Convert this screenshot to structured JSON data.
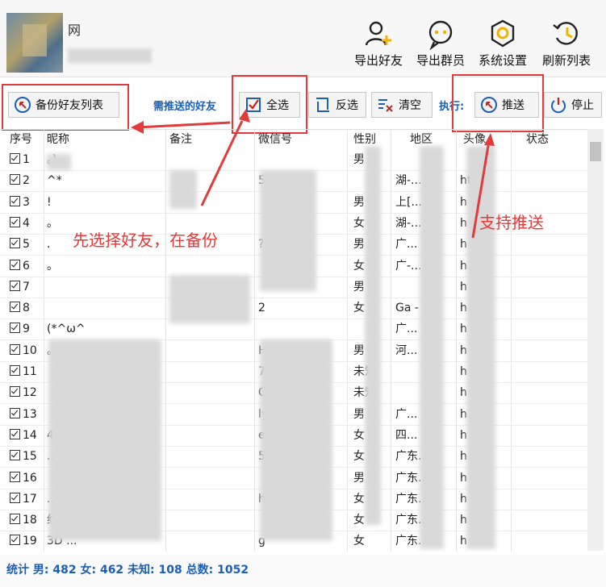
{
  "profile": {
    "name_tail": "网"
  },
  "toolbar": {
    "export_friends": "导出好友",
    "export_groups": "导出群员",
    "settings": "系统设置",
    "refresh": "刷新列表"
  },
  "actions": {
    "backup": "备份好友列表",
    "need_push_label": "需推送的好友",
    "select_all": "全选",
    "invert": "反选",
    "clear": "清空",
    "execute_label": "执行:",
    "push": "推送",
    "stop": "停止"
  },
  "columns": [
    "序号",
    "昵称",
    "备注",
    "微信号",
    "性别",
    "地区",
    "头像",
    "状态"
  ],
  "rows": [
    {
      "no": "1",
      "nick": "。)",
      "note": "",
      "wxid": "",
      "gender": "男",
      "region": "",
      "avatar": ""
    },
    {
      "no": "2",
      "nick": "^*",
      "note": "",
      "wxid": "54...",
      "gender": "",
      "region": "湖-...",
      "avatar": "ht"
    },
    {
      "no": "3",
      "nick": "!",
      "note": "",
      "wxid": "",
      "gender": "男",
      "region": "上[...",
      "avatar": "h"
    },
    {
      "no": "4",
      "nick": "。",
      "note": "",
      "wxid": "",
      "gender": "女",
      "region": "湖-...",
      "avatar": "h"
    },
    {
      "no": "5",
      "nick": ".",
      "note": "",
      "wxid": "?8",
      "gender": "男",
      "region": "广...",
      "avatar": "h"
    },
    {
      "no": "6",
      "nick": "。",
      "note": "",
      "wxid": "",
      "gender": "女",
      "region": "广-...",
      "avatar": "h"
    },
    {
      "no": "7",
      "nick": "",
      "note": "",
      "wxid": "",
      "gender": "男",
      "region": "",
      "avatar": "h /..."
    },
    {
      "no": "8",
      "nick": "",
      "note": "",
      "wxid": "2",
      "gender": "女",
      "region": "Ga -",
      "avatar": "h /..."
    },
    {
      "no": "9",
      "nick": "(*^ω^",
      "note": "",
      "wxid": "",
      "gender": "",
      "region": "广...",
      "avatar": "h /..."
    },
    {
      "no": "10",
      "nick": "。",
      "note": "",
      "wxid": "H",
      "gender": "男",
      "region": "河...",
      "avatar": "h /..."
    },
    {
      "no": "11",
      "nick": "",
      "note": "",
      "wxid": "7",
      "gender": "未知",
      "region": "",
      "avatar": "h /..."
    },
    {
      "no": "12",
      "nick": "",
      "note": "",
      "wxid": "G2",
      "gender": "未知",
      "region": "",
      "avatar": "h /..."
    },
    {
      "no": "13",
      "nick": "",
      "note": "",
      "wxid": "ly 021",
      "gender": "男",
      "region": "广...",
      "avatar": "h"
    },
    {
      "no": "14",
      "nick": "4755 (蒂蒂)",
      "note": "",
      "wxid": "eo",
      "gender": "女",
      "region": "四...",
      "avatar": "h"
    },
    {
      "no": "15",
      "nick": "...",
      "note": "",
      "wxid": "5...",
      "gender": "女",
      "region": "广东...",
      "avatar": "h"
    },
    {
      "no": "16",
      "nick": "",
      "note": "",
      "wxid": "",
      "gender": "男",
      "region": "广东...",
      "avatar": "h"
    },
    {
      "no": "17",
      "nick": "...",
      "note": "",
      "wxid": "hi",
      "gender": "女",
      "region": "广东...",
      "avatar": "h"
    },
    {
      "no": "18",
      "nick": "约...",
      "note": "",
      "wxid": "",
      "gender": "女",
      "region": "广东...",
      "avatar": "h"
    },
    {
      "no": "19",
      "nick": "3D ...",
      "note": "",
      "wxid": "g",
      "gender": "女",
      "region": "广东...",
      "avatar": "h"
    }
  ],
  "status": {
    "label": "统计 男:",
    "male": "482",
    "female_label": "女:",
    "female": "462",
    "unknown_label": "未知:",
    "unknown": "108",
    "total_label": "总数:",
    "total": "1052"
  },
  "annotations": {
    "hint_select": "先选择好友，在备份",
    "hint_push": "支持推送"
  },
  "colors": {
    "accent": "#1b5fb8",
    "annotation": "#e23b3b"
  }
}
